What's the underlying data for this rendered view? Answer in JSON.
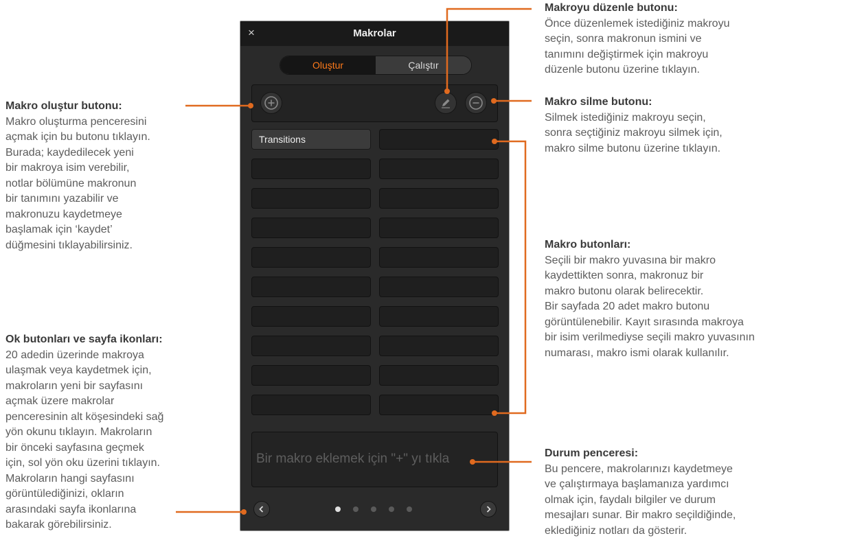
{
  "window": {
    "title": "Makrolar",
    "close_glyph": "×",
    "tabs": [
      {
        "label": "Oluştur",
        "active": true
      },
      {
        "label": "Çalıştır",
        "active": false
      }
    ],
    "toolbar": {
      "add_icon": "plus-circle-icon",
      "edit_icon": "pencil-icon",
      "delete_icon": "minus-circle-icon"
    },
    "macro_buttons": [
      "Transitions",
      "",
      "",
      "",
      "",
      "",
      "",
      "",
      "",
      "",
      "",
      "",
      "",
      "",
      "",
      "",
      "",
      "",
      "",
      ""
    ],
    "status_text": "Bir makro eklemek için \"+\" yı tıkla",
    "pager": {
      "pages": 5,
      "current": 1
    },
    "accent_color": "#ff7a1a"
  },
  "annotations": {
    "create": {
      "title": "Makro oluştur butonu:",
      "body": "Makro oluşturma penceresini\naçmak için bu butonu tıklayın.\nBurada; kaydedilecek yeni\nbir makroya isim verebilir,\nnotlar bölümüne makronun\nbir tanımını yazabilir ve\nmakronuzu kaydetmeye\nbaşlamak için ‘kaydet’\ndüğmesini tıklayabilirsiniz."
    },
    "arrows": {
      "title": "Ok butonları ve sayfa ikonları:",
      "body": "20 adedin üzerinde makroya\nulaşmak veya kaydetmek için,\nmakroların yeni bir sayfasını\naçmak üzere makrolar\npenceresinin alt köşesindeki sağ\nyön okunu tıklayın. Makroların\nbir önceki sayfasına geçmek\niçin, sol yön oku üzerini tıklayın.\nMakroların hangi sayfasını\ngörüntülediğinizi, okların\narasındaki sayfa ikonlarına\nbakarak görebilirsiniz."
    },
    "edit": {
      "title": "Makroyu düzenle butonu:",
      "body": "Önce düzenlemek istediğiniz makroyu\nseçin, sonra makronun ismini ve\ntanımını değiştirmek için makroyu\ndüzenle butonu üzerine tıklayın."
    },
    "delete": {
      "title": "Makro silme butonu:",
      "body": " Silmek istediğiniz makroyu seçin,\nsonra seçtiğiniz makroyu silmek için,\nmakro silme butonu üzerine tıklayın."
    },
    "macros": {
      "title": "Makro butonları:",
      "body": "Seçili bir makro yuvasına bir makro\nkaydettikten sonra, makronuz bir\nmakro butonu olarak belirecektir.\nBir sayfada 20 adet makro butonu\ngörüntülenebilir. Kayıt sırasında makroya\nbir isim verilmediyse seçili makro yuvasının\nnumarası, makro ismi olarak kullanılır."
    },
    "status": {
      "title": "Durum penceresi:",
      "body": "Bu pencere, makrolarınızı kaydetmeye\nve çalıştırmaya başlamanıza yardımcı\nolmak için, faydalı bilgiler ve durum\nmesajları sunar. Bir makro seçildiğinde,\neklediğiniz notları da gösterir."
    }
  }
}
